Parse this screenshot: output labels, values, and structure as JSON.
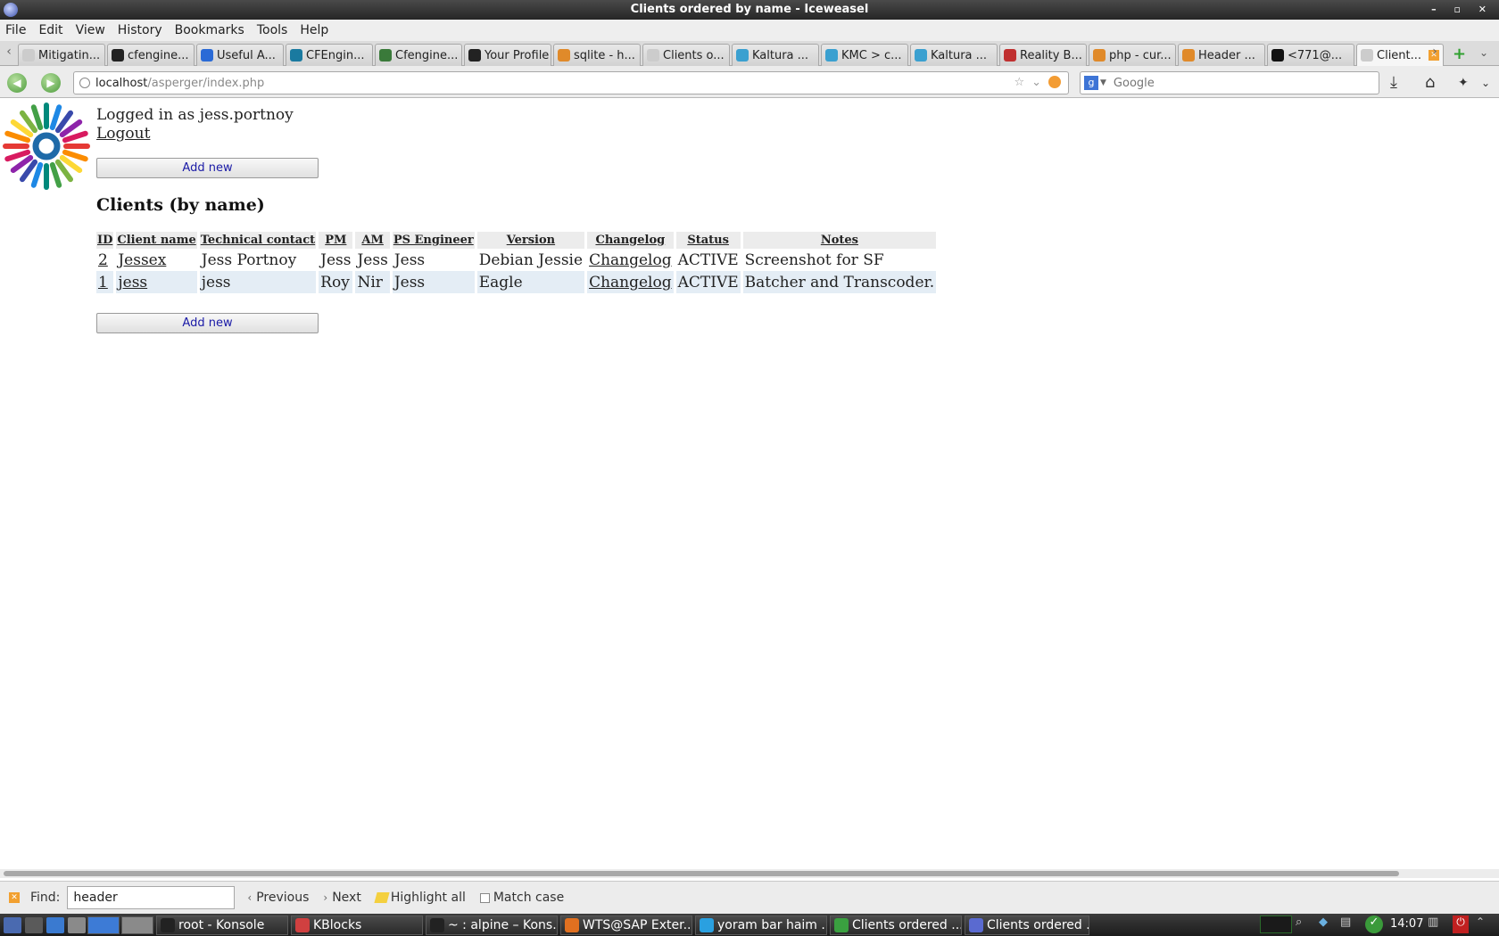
{
  "window": {
    "title": "Clients ordered by name - Iceweasel"
  },
  "menu": [
    "File",
    "Edit",
    "View",
    "History",
    "Bookmarks",
    "Tools",
    "Help"
  ],
  "tabs": [
    {
      "label": "Mitigatin...",
      "icon": "page-icon",
      "color": "#cccccc"
    },
    {
      "label": "cfengine...",
      "icon": "github-icon",
      "color": "#222222"
    },
    {
      "label": "Useful A...",
      "icon": "n-icon",
      "color": "#2a6ad6"
    },
    {
      "label": "CFEngin...",
      "icon": "cfengine-icon",
      "color": "#1a7aa0"
    },
    {
      "label": "Cfengine...",
      "icon": "cfengine-icon",
      "color": "#3a7a3a"
    },
    {
      "label": "Your Profile",
      "icon": "github-icon",
      "color": "#222222"
    },
    {
      "label": "sqlite - h...",
      "icon": "stackoverflow-icon",
      "color": "#e08a2a"
    },
    {
      "label": "Clients o...",
      "icon": "page-icon",
      "color": "#cccccc"
    },
    {
      "label": "Kaltura ...",
      "icon": "kaltura-icon",
      "color": "#3aa0d0"
    },
    {
      "label": "KMC > c...",
      "icon": "kaltura-icon",
      "color": "#3aa0d0"
    },
    {
      "label": "Kaltura ...",
      "icon": "kaltura-icon",
      "color": "#3aa0d0"
    },
    {
      "label": "Reality B...",
      "icon": "reality-icon",
      "color": "#c03030"
    },
    {
      "label": "php - cur...",
      "icon": "stackoverflow-icon",
      "color": "#e08a2a"
    },
    {
      "label": "Header ...",
      "icon": "stackoverflow-icon",
      "color": "#e08a2a"
    },
    {
      "label": "<771@...",
      "icon": "terminal-icon",
      "color": "#111111"
    },
    {
      "label": "Client...",
      "icon": "page-icon",
      "color": "#cccccc",
      "active": true
    }
  ],
  "nav": {
    "url_host": "localhost",
    "url_path": "/asperger/index.php",
    "search_placeholder": "Google"
  },
  "page": {
    "login_text": "Logged in as jess.portnoy",
    "logout_label": "Logout",
    "add_new_label": "Add new",
    "heading": "Clients (by name)",
    "table": {
      "headers": [
        "ID",
        "Client name",
        "Technical contact",
        "PM",
        "AM",
        "PS Engineer",
        "Version",
        "Changelog",
        "Status",
        "Notes"
      ],
      "rows": [
        [
          "2",
          "Jessex",
          "Jess Portnoy",
          "Jess",
          "Jess",
          "Jess",
          "Debian Jessie",
          "Changelog",
          "ACTIVE",
          "Screenshot for SF"
        ],
        [
          "1",
          "jess",
          "jess",
          "Roy",
          "Nir",
          "Jess",
          "Eagle",
          "Changelog",
          "ACTIVE",
          "Batcher and Transcoder."
        ]
      ]
    }
  },
  "findbar": {
    "label": "Find:",
    "value": "header",
    "previous": "Previous",
    "next": "Next",
    "highlight_all": "Highlight all",
    "match_case": "Match case"
  },
  "taskbar": {
    "tasks": [
      {
        "label": "root - Konsole",
        "icon": "konsole-icon",
        "color": "#222222"
      },
      {
        "label": "KBlocks",
        "icon": "kblocks-icon",
        "color": "#d04040"
      },
      {
        "label": "~ : alpine – Kons...",
        "icon": "konsole-icon",
        "color": "#222222"
      },
      {
        "label": "WTS@SAP Exter...",
        "icon": "firefox-icon",
        "color": "#e07020"
      },
      {
        "label": "yoram bar haim ...",
        "icon": "skype-icon",
        "color": "#2aa0e0"
      },
      {
        "label": "Clients ordered ...",
        "icon": "chrome-icon",
        "color": "#3aa040"
      },
      {
        "label": "Clients ordered ...",
        "icon": "iceweasel-icon",
        "color": "#5a6ad0"
      }
    ],
    "clock": "14:07"
  }
}
